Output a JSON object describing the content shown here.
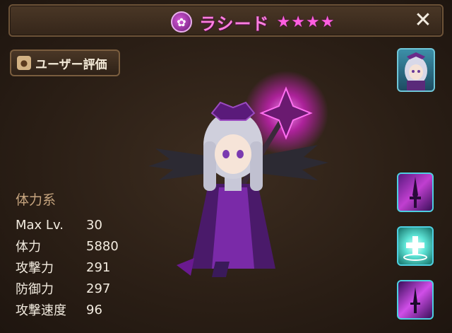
{
  "header": {
    "element_icon": "dark-element-icon",
    "name": "ラシード",
    "stars": [
      "★",
      "★",
      "★",
      "★"
    ],
    "close_label": "✕"
  },
  "review_button": {
    "label": "ユーザー評価",
    "icon": "user-review-icon"
  },
  "stats": {
    "heading": "体力系",
    "rows": [
      {
        "label": "Max Lv.",
        "value": "30"
      },
      {
        "label": "体力",
        "value": "5880"
      },
      {
        "label": "攻撃力",
        "value": "291"
      },
      {
        "label": "防御力",
        "value": "297"
      },
      {
        "label": "攻撃速度",
        "value": "96"
      }
    ]
  },
  "colors": {
    "title": "#ff7fe0",
    "star": "#ff5fe0",
    "skill_border": "#4ecfe0",
    "stat_heading": "#c7a57f"
  }
}
